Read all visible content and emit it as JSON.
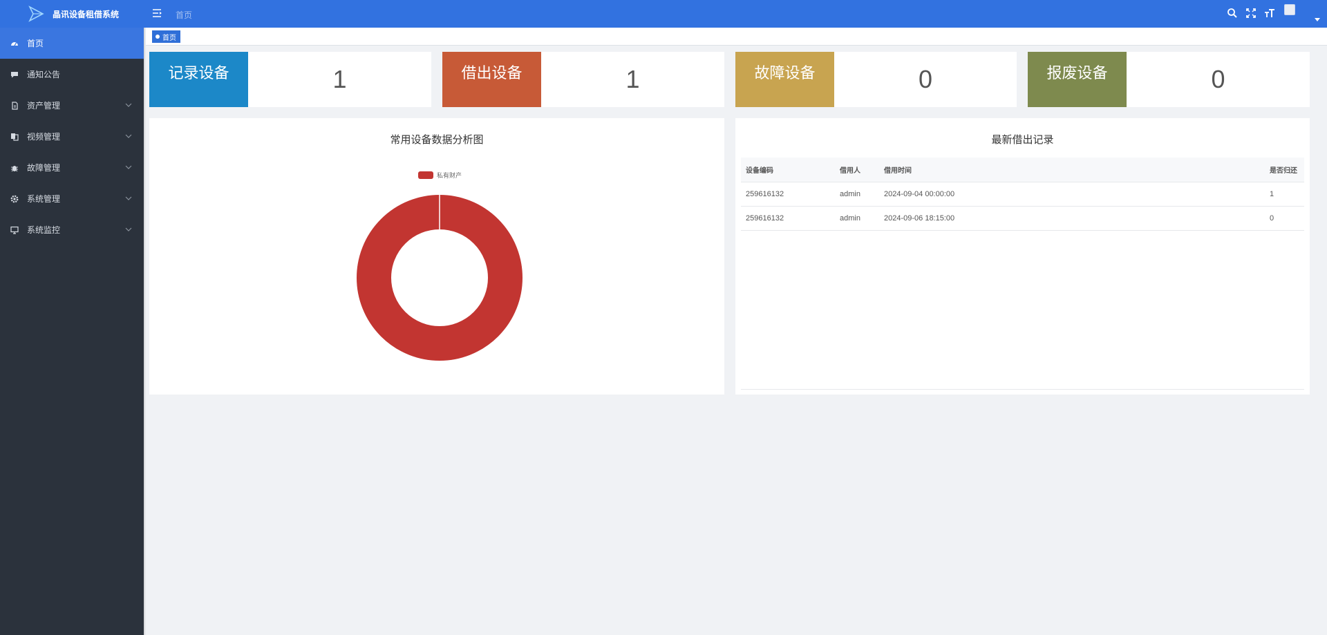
{
  "app": {
    "title": "晶讯设备租借系统"
  },
  "sidebar": {
    "items": [
      {
        "label": "首页",
        "icon": "dashboard-icon",
        "active": true
      },
      {
        "label": "通知公告",
        "icon": "message-icon"
      },
      {
        "label": "资产管理",
        "icon": "document-icon"
      },
      {
        "label": "视频管理",
        "icon": "copy-icon"
      },
      {
        "label": "故障管理",
        "icon": "bug-icon"
      },
      {
        "label": "系统管理",
        "icon": "gear-icon"
      },
      {
        "label": "系统监控",
        "icon": "monitor-icon"
      }
    ]
  },
  "header": {
    "breadcrumb": "首页"
  },
  "tags": {
    "active_tag": "首页"
  },
  "stats": [
    {
      "label": "记录设备",
      "value": "1",
      "color": "#1c88c8"
    },
    {
      "label": "借出设备",
      "value": "1",
      "color": "#c75a37"
    },
    {
      "label": "故障设备",
      "value": "0",
      "color": "#c8a450"
    },
    {
      "label": "报废设备",
      "value": "0",
      "color": "#7e8a4e"
    }
  ],
  "chart_panel": {
    "title": "常用设备数据分析图"
  },
  "chart_data": {
    "type": "pie",
    "title": "常用设备数据分析图",
    "categories": [
      "私有财产"
    ],
    "values": [
      1
    ],
    "colors": [
      "#c23531"
    ],
    "legend": "top"
  },
  "records": {
    "title": "最新借出记录",
    "columns": [
      "设备编码",
      "借用人",
      "借用时间",
      "是否归还"
    ],
    "rows": [
      [
        "259616132",
        "admin",
        "2024-09-04 00:00:00",
        "1"
      ],
      [
        "259616132",
        "admin",
        "2024-09-06 18:15:00",
        "0"
      ]
    ]
  }
}
